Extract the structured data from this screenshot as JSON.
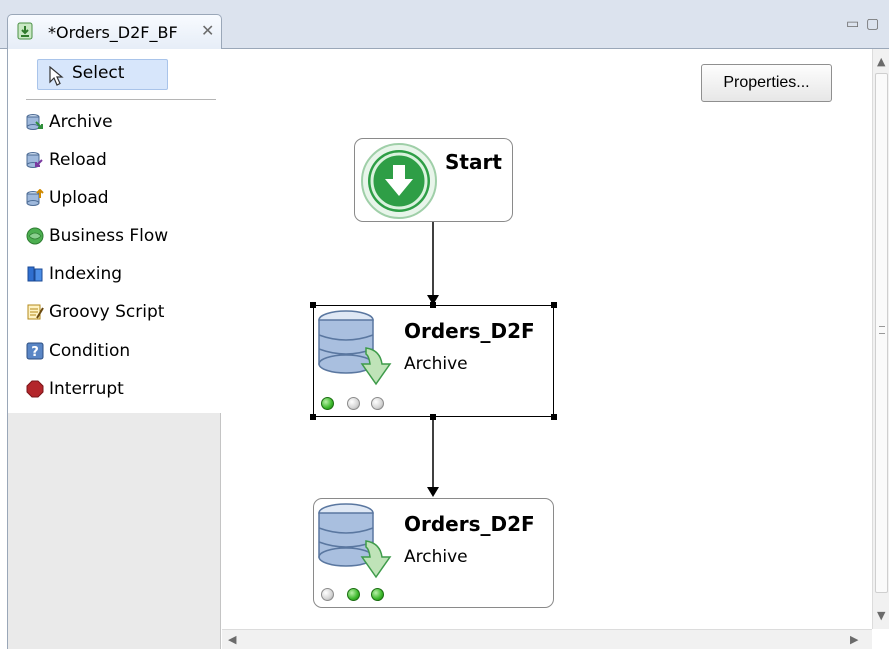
{
  "editor_tab": {
    "title": "*Orders_D2F_BF",
    "close_glyph": "✕"
  },
  "window_controls": {
    "minimize": "▭",
    "maximize": "▢"
  },
  "palette": {
    "select_label": "Select",
    "items": [
      {
        "label": "Archive",
        "icon": "archive-icon"
      },
      {
        "label": "Reload",
        "icon": "reload-icon"
      },
      {
        "label": "Upload",
        "icon": "upload-icon"
      },
      {
        "label": "Business Flow",
        "icon": "business-flow-icon"
      },
      {
        "label": "Indexing",
        "icon": "indexing-icon"
      },
      {
        "label": "Groovy Script",
        "icon": "groovy-script-icon"
      },
      {
        "label": "Condition",
        "icon": "condition-icon"
      },
      {
        "label": "Interrupt",
        "icon": "interrupt-icon"
      }
    ]
  },
  "canvas": {
    "properties_button": "Properties...",
    "nodes": [
      {
        "title": "Start",
        "icon": "start-icon"
      },
      {
        "title": "Orders_D2F",
        "subtitle": "Archive",
        "icon": "archive-database-icon",
        "selected": true,
        "status": [
          "green",
          "gray",
          "gray"
        ]
      },
      {
        "title": "Orders_D2F",
        "subtitle": "Archive",
        "icon": "archive-database-icon",
        "selected": false,
        "status": [
          "gray",
          "green",
          "green"
        ]
      }
    ]
  },
  "colors": {
    "tab_strip": "#dce3ee",
    "selection": "#d7e6fb",
    "status_green": "#3bb72a",
    "start_green": "#2e9e46"
  }
}
